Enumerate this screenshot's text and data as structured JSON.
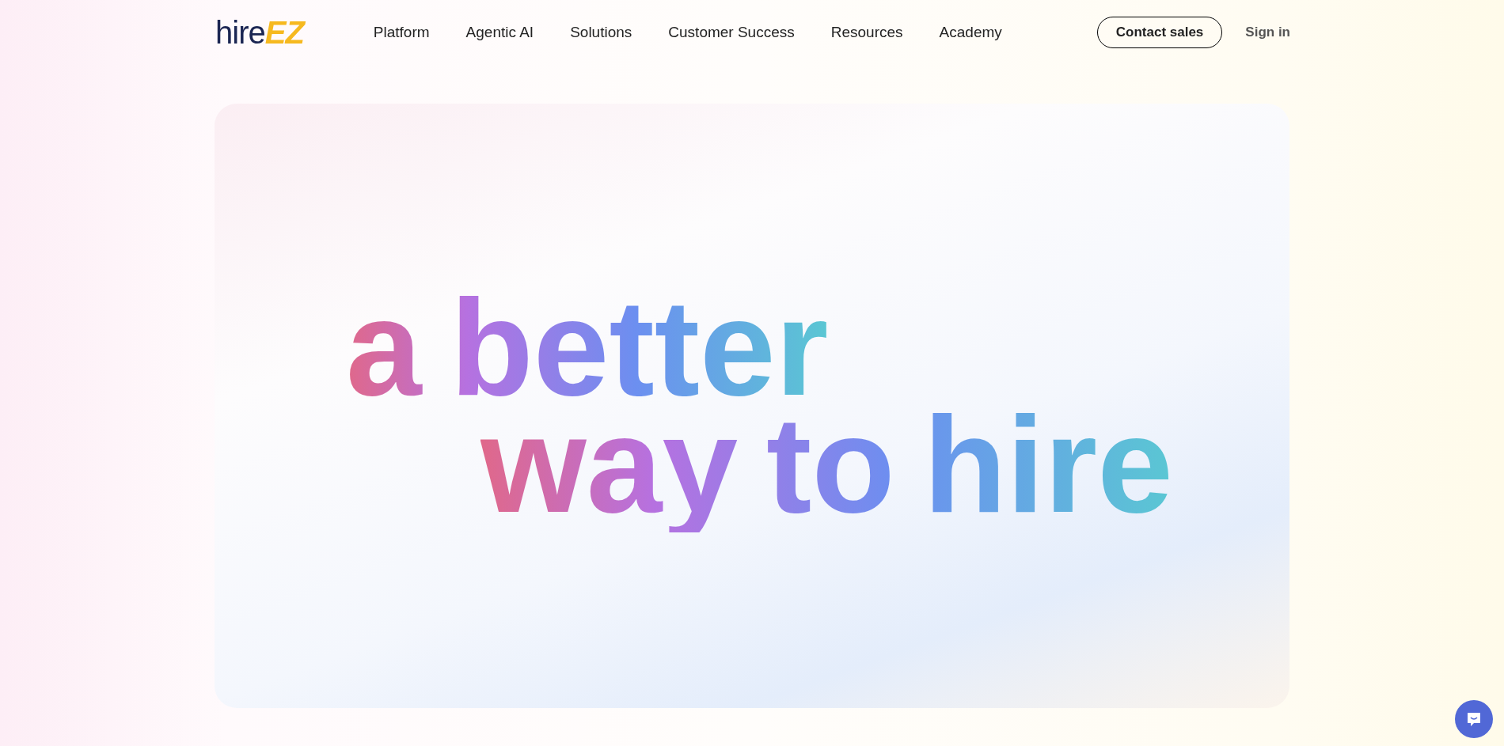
{
  "logo": {
    "word": "hire",
    "mark": "EZ"
  },
  "nav": [
    "Platform",
    "Agentic AI",
    "Solutions",
    "Customer Success",
    "Resources",
    "Academy"
  ],
  "actions": {
    "contact": "Contact sales",
    "sign_in": "Sign in"
  },
  "hero": {
    "lines": [
      "a better",
      "way to hire"
    ]
  }
}
